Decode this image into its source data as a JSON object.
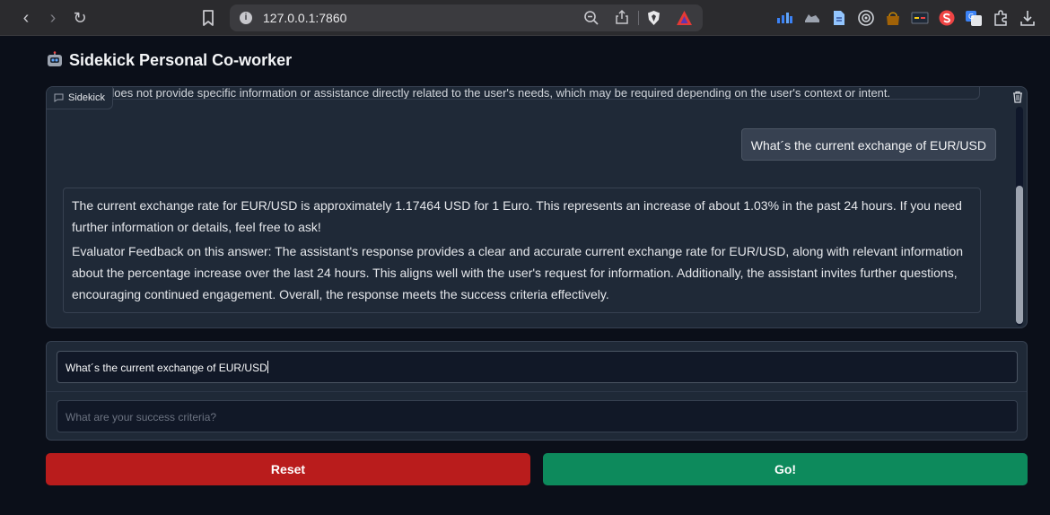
{
  "browser": {
    "url": "127.0.0.1:7860",
    "icons": [
      "back-icon",
      "forward-icon",
      "reload-icon",
      "bookmark-icon",
      "site-info-icon",
      "zoom-icon",
      "share-icon",
      "brave-shields-icon",
      "brave-rewards-icon",
      "extensions-icon",
      "downloads-icon"
    ]
  },
  "app": {
    "title": "Sidekick Personal Co-worker",
    "title_icon": "robot-emoji"
  },
  "chatbot": {
    "label": "Sidekick",
    "cut_off_message": "...er, it does not provide specific information or assistance directly related to the user's needs, which may be required depending on the user's context or intent.",
    "user_message": "What´s the current exchange of EUR/USD",
    "bot_message_p1": "The current exchange rate for EUR/USD is approximately 1.17464 USD for 1 Euro. This represents an increase of about 1.03% in the past 24 hours. If you need further information or details, feel free to ask!",
    "bot_message_p2": "Evaluator Feedback on this answer: The assistant's response provides a clear and accurate current exchange rate for EUR/USD, along with relevant information about the percentage increase over the last 24 hours. This aligns well with the user's request for information. Additionally, the assistant invites further questions, encouraging continued engagement. Overall, the response meets the success criteria effectively."
  },
  "inputs": {
    "message_value": "What´s the current exchange of EUR/USD",
    "criteria_placeholder": "What are your success criteria?"
  },
  "buttons": {
    "reset_label": "Reset",
    "go_label": "Go!"
  },
  "colors": {
    "reset": "#b91c1c",
    "go": "#0d8a5c",
    "background": "#0b0f19"
  }
}
